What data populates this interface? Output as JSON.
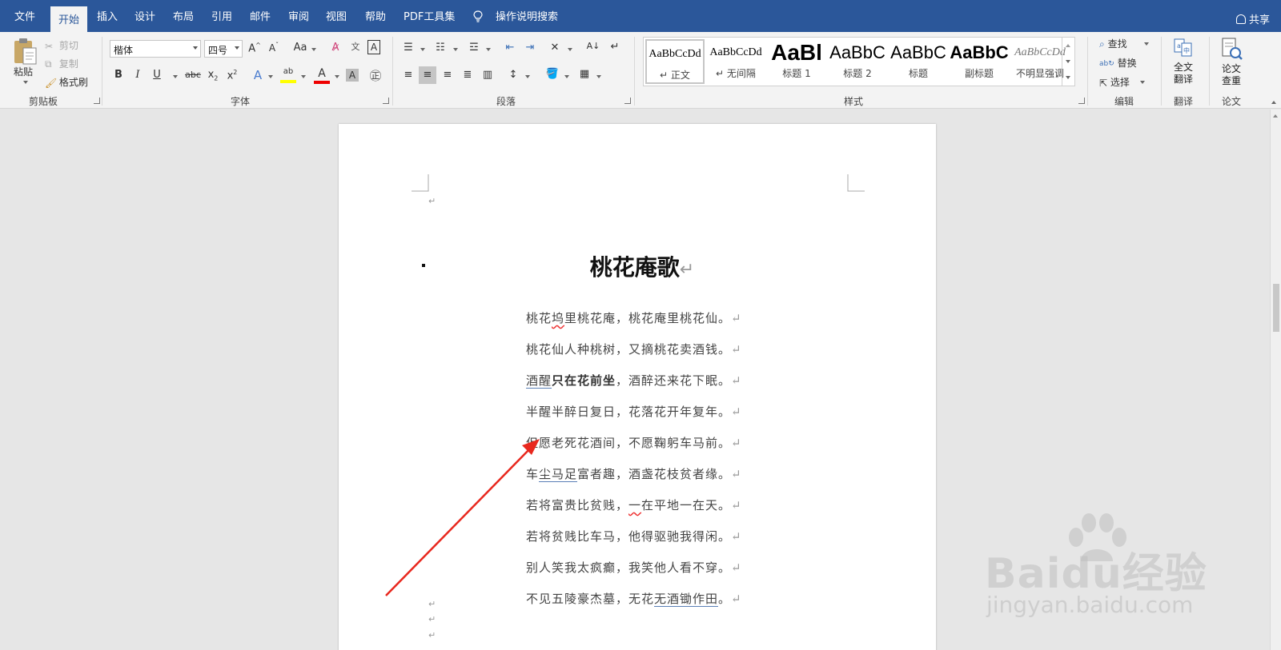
{
  "tabs": [
    {
      "label": "文件"
    },
    {
      "label": "开始"
    },
    {
      "label": "插入"
    },
    {
      "label": "设计"
    },
    {
      "label": "布局"
    },
    {
      "label": "引用"
    },
    {
      "label": "邮件"
    },
    {
      "label": "审阅"
    },
    {
      "label": "视图"
    },
    {
      "label": "帮助"
    },
    {
      "label": "PDF工具集"
    },
    {
      "label": "操作说明搜索"
    }
  ],
  "share_label": "共享",
  "clipboard": {
    "paste": "粘贴",
    "cut": "剪切",
    "copy": "复制",
    "format_painter": "格式刷",
    "group": "剪贴板"
  },
  "font": {
    "name": "楷体",
    "size": "四号",
    "group": "字体",
    "case_label": "Aa",
    "bold": "B",
    "italic": "I",
    "underline": "U",
    "strikethrough": "abc",
    "subscript": "x",
    "superscript": "x",
    "highlight_label": "ab",
    "font_color_label": "A",
    "char_shading_label": "A"
  },
  "paragraph": {
    "group": "段落"
  },
  "styles": {
    "group": "样式",
    "items": [
      {
        "sample": "AaBbCcDd",
        "name": "正文"
      },
      {
        "sample": "AaBbCcDd",
        "name": "无间隔"
      },
      {
        "sample": "AaBl",
        "name": "标题 1"
      },
      {
        "sample": "AaBbC",
        "name": "标题 2"
      },
      {
        "sample": "AaBbC",
        "name": "标题"
      },
      {
        "sample": "AaBbC",
        "name": "副标题"
      },
      {
        "sample": "AaBbCcDd",
        "name": "不明显强调"
      }
    ]
  },
  "editing": {
    "find": "查找",
    "replace": "替换",
    "select": "选择",
    "group": "编辑"
  },
  "translate": {
    "button_line1": "全文",
    "button_line2": "翻译",
    "group": "翻译"
  },
  "paper": {
    "button_line1": "论文",
    "button_line2": "查重",
    "group": "论文"
  },
  "document": {
    "title": "桃花庵歌",
    "lines": [
      {
        "a": "桃花",
        "b": "坞",
        "c": "里桃花庵，桃花庵里桃花仙。"
      },
      {
        "text": "桃花仙人种桃树，又摘桃花卖酒钱。"
      },
      {
        "a": "酒醒",
        "b": "只在花前坐",
        "c": "，酒醉还来花下眠。"
      },
      {
        "text": "半醒半醉日复日，花落花开年复年。"
      },
      {
        "text": "但愿老死花酒间，不愿鞠躬车马前。"
      },
      {
        "a": "车",
        "b": "尘马足",
        "c": "富者趣，酒盏花枝贫者缘。"
      },
      {
        "a": "若将富贵比贫贱，",
        "b": "一",
        "c": "在平地一在天。"
      },
      {
        "text": "若将贫贱比车马，他得驱驰我得闲。"
      },
      {
        "text": "别人笑我太疯癫，我笑他人看不穿。"
      },
      {
        "a": "不见五陵豪杰墓，无花",
        "b": "无酒锄作田",
        "c": "。"
      }
    ]
  },
  "colors": {
    "tab_bar": "#2b579a",
    "ribbon": "#f3f3f3",
    "arrow": "#e8281e",
    "blue_underline": "#5a7fb6"
  },
  "watermark": {
    "brand": "Baidu经验",
    "url": "jingyan.baidu.com"
  }
}
